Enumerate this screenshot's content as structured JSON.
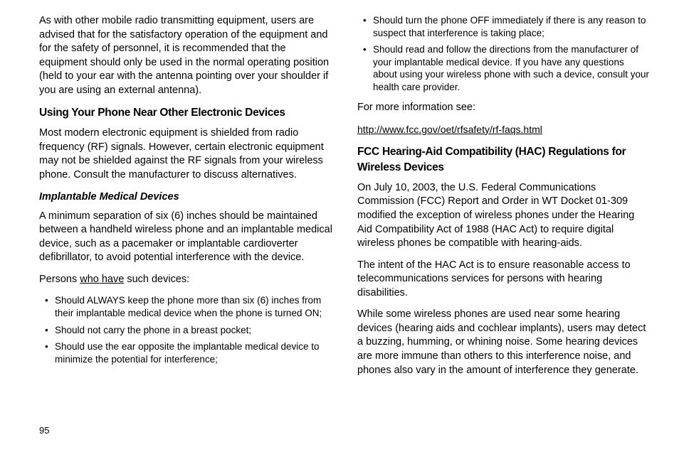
{
  "pageNumber": "95",
  "leftColumn": {
    "para1": "As with other mobile radio transmitting equipment, users are advised that for the satisfactory operation of the equipment and for the safety of personnel, it is recommended that the equipment should only be used in the normal operating position (held to your ear with the antenna pointing over your shoulder if you are using an external antenna).",
    "heading1": "Using Your Phone Near Other Electronic Devices",
    "para2": "Most modern electronic equipment is shielded from radio frequency (RF) signals. However, certain electronic equipment may not be shielded against the RF signals from your wireless phone. Consult the manufacturer to discuss alternatives.",
    "heading2": "Implantable Medical Devices",
    "para3": "A minimum separation of six (6) inches should be maintained between a handheld wireless phone and an implantable medical device, such as a pacemaker or implantable cardioverter defibrillator, to avoid potential interference with the device.",
    "para4_pre": "Persons ",
    "para4_underline": "who have",
    "para4_post": " such devices:",
    "bullets": [
      "Should ALWAYS keep the phone more than six (6) inches from their implantable medical device when the phone is turned ON;",
      "Should not carry the phone in a breast pocket;",
      "Should use the ear opposite the implantable medical device to minimize the potential for interference;"
    ]
  },
  "rightColumn": {
    "bullets": [
      "Should turn the phone OFF immediately if there is any reason to suspect that interference is taking place;",
      "Should read and follow the directions from the manufacturer of your implantable medical device. If you have any questions about using your wireless phone with such a device, consult your health care provider."
    ],
    "para1": "For more information see:",
    "link": "http://www.fcc.gov/oet/rfsafety/rf-faqs.html",
    "heading1": "FCC Hearing-Aid Compatibility (HAC) Regulations for Wireless Devices",
    "para2": "On July 10, 2003, the U.S. Federal Communications Commission (FCC) Report and Order in WT Docket 01-309 modified the exception of wireless phones under the Hearing Aid Compatibility Act of 1988 (HAC Act) to require digital wireless phones be compatible with hearing-aids.",
    "para3": "The intent of the HAC Act is to ensure reasonable access to telecommunications services for persons with hearing disabilities.",
    "para4": "While some wireless phones are used near some hearing devices (hearing aids and cochlear implants), users may detect a buzzing, humming, or whining noise. Some hearing devices are more immune than others to this interference noise, and phones also vary in the amount of interference they generate."
  }
}
